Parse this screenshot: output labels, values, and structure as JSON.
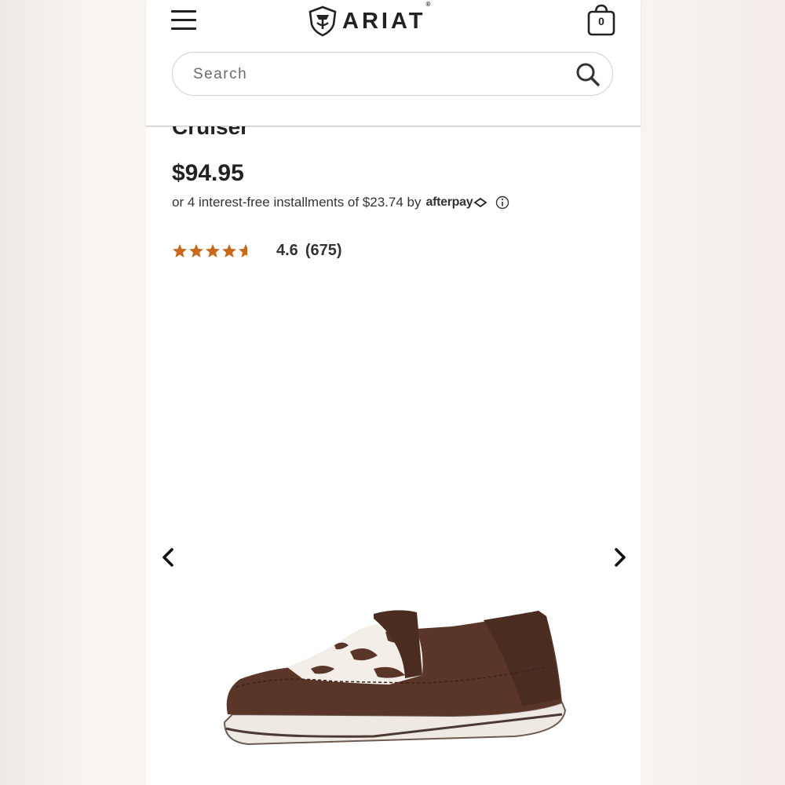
{
  "header": {
    "brand": "ARIAT",
    "brand_mark": "®",
    "cart_count": "0",
    "search_placeholder": "Search"
  },
  "product": {
    "title": "Cruiser",
    "price": "$94.95",
    "installments_text": "or 4 interest-free installments of $23.74 by",
    "afterpay_label": "afterpay",
    "rating_value": "4.6",
    "rating_count": "(675)",
    "rating_stars": 4.6,
    "star_color": "#c8691c"
  },
  "gallery": {
    "prev_icon": "chevron-left-icon",
    "next_icon": "chevron-right-icon",
    "image": "brown-suede-cruiser-shoe-with-cowhide-print"
  },
  "colors": {
    "brown": "#5a3628",
    "star": "#c8691c",
    "text": "#222222"
  }
}
